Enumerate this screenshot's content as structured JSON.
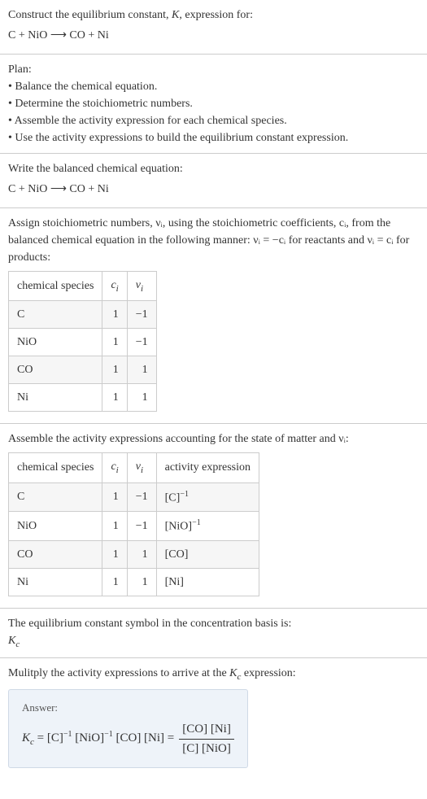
{
  "intro": {
    "title": "Construct the equilibrium constant, K, expression for:",
    "equation": "C + NiO ⟶ CO + Ni"
  },
  "plan": {
    "heading": "Plan:",
    "items": [
      "• Balance the chemical equation.",
      "• Determine the stoichiometric numbers.",
      "• Assemble the activity expression for each chemical species.",
      "• Use the activity expressions to build the equilibrium constant expression."
    ]
  },
  "balanced": {
    "heading": "Write the balanced chemical equation:",
    "equation": "C + NiO ⟶ CO + Ni"
  },
  "stoich": {
    "text_before": "Assign stoichiometric numbers, νᵢ, using the stoichiometric coefficients, cᵢ, from the balanced chemical equation in the following manner: νᵢ = −cᵢ for reactants and νᵢ = cᵢ for products:",
    "headers": {
      "species": "chemical species",
      "ci": "cᵢ",
      "vi": "νᵢ"
    },
    "rows": [
      {
        "species": "C",
        "ci": "1",
        "vi": "−1"
      },
      {
        "species": "NiO",
        "ci": "1",
        "vi": "−1"
      },
      {
        "species": "CO",
        "ci": "1",
        "vi": "1"
      },
      {
        "species": "Ni",
        "ci": "1",
        "vi": "1"
      }
    ]
  },
  "activity": {
    "text_before": "Assemble the activity expressions accounting for the state of matter and νᵢ:",
    "headers": {
      "species": "chemical species",
      "ci": "cᵢ",
      "vi": "νᵢ",
      "expr": "activity expression"
    },
    "rows": [
      {
        "species": "C",
        "ci": "1",
        "vi": "−1",
        "expr": "[C]⁻¹"
      },
      {
        "species": "NiO",
        "ci": "1",
        "vi": "−1",
        "expr": "[NiO]⁻¹"
      },
      {
        "species": "CO",
        "ci": "1",
        "vi": "1",
        "expr": "[CO]"
      },
      {
        "species": "Ni",
        "ci": "1",
        "vi": "1",
        "expr": "[Ni]"
      }
    ]
  },
  "symbol": {
    "text": "The equilibrium constant symbol in the concentration basis is:",
    "value": "K꜀"
  },
  "multiply": {
    "text": "Mulitply the activity expressions to arrive at the K꜀ expression:"
  },
  "answer": {
    "label": "Answer:",
    "lhs": "K꜀ = [C]⁻¹ [NiO]⁻¹ [CO] [Ni] =",
    "num": "[CO] [Ni]",
    "den": "[C] [NiO]"
  }
}
